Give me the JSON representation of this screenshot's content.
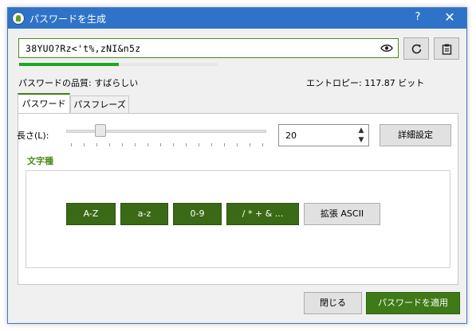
{
  "window": {
    "title": "パスワードを生成",
    "help_label": "?",
    "close_label": "✕"
  },
  "password": {
    "value": "38YUO?Rz<'t%,zNI&n5z",
    "strength_fraction": 0.5,
    "quality_text": "パスワードの品質: すばらしい",
    "entropy_text": "エントロピー: 117.87 ビット"
  },
  "icons": {
    "eye": "eye-icon",
    "refresh": "refresh-icon",
    "clipboard": "clipboard-icon"
  },
  "tabs": [
    {
      "label": "パスワード",
      "active": true
    },
    {
      "label": "パスフレーズ",
      "active": false
    }
  ],
  "length": {
    "label": "長さ(L):",
    "value": "20",
    "advanced_label": "詳細設定"
  },
  "charset": {
    "title": "文字種",
    "buttons": [
      {
        "label": "A-Z",
        "on": true
      },
      {
        "label": "a-z",
        "on": true
      },
      {
        "label": "0-9",
        "on": true
      },
      {
        "label": "/ * + & ...",
        "on": true
      },
      {
        "label": "拡張 ASCII",
        "on": false
      }
    ]
  },
  "footer": {
    "close_label": "閉じる",
    "apply_label": "パスワードを適用"
  },
  "colors": {
    "titlebar": "#2f73c8",
    "accent": "#3b6a16",
    "meter": "#1ea821"
  }
}
